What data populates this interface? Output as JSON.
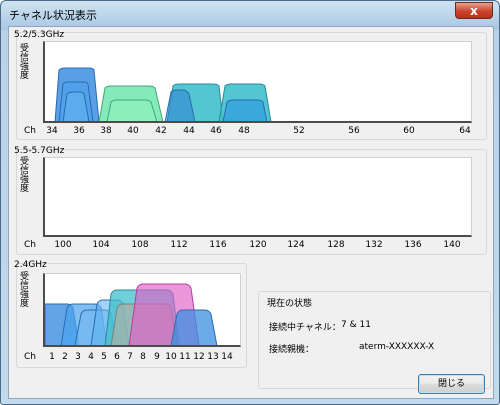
{
  "window": {
    "title": "チャネル状況表示",
    "close_glyph": "x"
  },
  "panels": {
    "band_52_53": {
      "label": "5.2/5.3GHz",
      "y_label_chars": [
        "受",
        "信",
        "強",
        "度"
      ],
      "axis_prefix": "Ch",
      "ticks": [
        "34",
        "36",
        "38",
        "40",
        "42",
        "44",
        "46",
        "48",
        "52",
        "56",
        "60",
        "64"
      ]
    },
    "band_55_57": {
      "label": "5.5-5.7GHz",
      "y_label_chars": [
        "受",
        "信",
        "強",
        "度"
      ],
      "axis_prefix": "Ch",
      "ticks": [
        "100",
        "104",
        "108",
        "112",
        "116",
        "120",
        "124",
        "128",
        "132",
        "136",
        "140"
      ]
    },
    "band_24": {
      "label": "2.4GHz",
      "y_label_chars": [
        "受",
        "信",
        "強",
        "度"
      ],
      "axis_prefix": "Ch",
      "ticks": [
        "1",
        "2",
        "3",
        "4",
        "5",
        "6",
        "7",
        "8",
        "9",
        "10",
        "11",
        "12",
        "13",
        "14"
      ]
    }
  },
  "status": {
    "title": "現在の状態",
    "channel_label": "接続中チャネル：",
    "channel_value": "7 & 11",
    "parent_label": "接続親機：",
    "parent_value": "aterm-XXXXXX-X"
  },
  "buttons": {
    "close_label": "閉じる"
  },
  "colors": {
    "blue": "#3b8ee0",
    "green": "#6fe6ad",
    "teal": "#40c0cc",
    "magenta": "#e060c8",
    "gray": "#a8b0a8"
  }
}
